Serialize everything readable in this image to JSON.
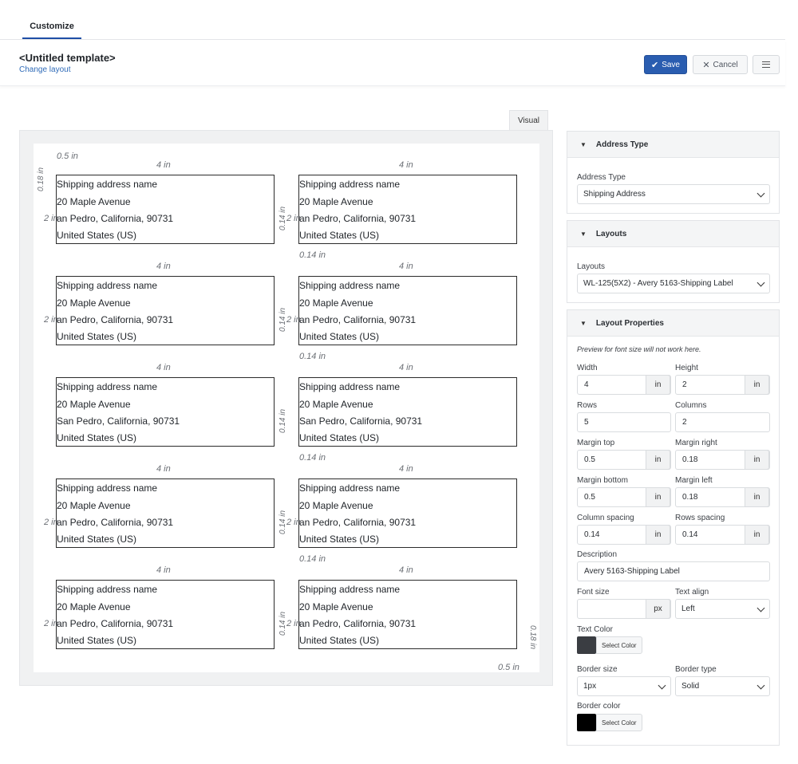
{
  "tabs": {
    "customize": "Customize",
    "visual": "Visual"
  },
  "header": {
    "title": "<Untitled template>",
    "change_layout": "Change layout",
    "save_label": "Save",
    "cancel_label": "Cancel"
  },
  "canvas": {
    "margin_top_label": "0.5 in",
    "margin_bottom_label": "0.5 in",
    "margin_side_label": "0.18 in",
    "width_label": "4 in",
    "height_label": "2 in",
    "spacing_label": "0.14 in",
    "label_lines": {
      "name": "Shipping address name",
      "street": "20 Maple Avenue",
      "city": "San Pedro, California, 90731",
      "city_clipped": "an Pedro, California, 90731",
      "country": "United States (US)"
    }
  },
  "panel": {
    "address_type": {
      "header": "Address Type",
      "field_label": "Address Type",
      "value": "Shipping Address"
    },
    "layouts": {
      "header": "Layouts",
      "field_label": "Layouts",
      "value": "WL-125(5X2) - Avery 5163-Shipping Label"
    },
    "props": {
      "header": "Layout Properties",
      "note": "Preview for font size will not work here.",
      "width_label": "Width",
      "width": "4",
      "width_unit": "in",
      "height_label": "Height",
      "height": "2",
      "height_unit": "in",
      "rows_label": "Rows",
      "rows": "5",
      "columns_label": "Columns",
      "columns": "2",
      "margin_top_label": "Margin top",
      "margin_top": "0.5",
      "margin_top_unit": "in",
      "margin_right_label": "Margin right",
      "margin_right": "0.18",
      "margin_right_unit": "in",
      "margin_bottom_label": "Margin bottom",
      "margin_bottom": "0.5",
      "margin_bottom_unit": "in",
      "margin_left_label": "Margin left",
      "margin_left": "0.18",
      "margin_left_unit": "in",
      "column_spacing_label": "Column spacing",
      "column_spacing": "0.14",
      "column_spacing_unit": "in",
      "rows_spacing_label": "Rows spacing",
      "rows_spacing": "0.14",
      "rows_spacing_unit": "in",
      "description_label": "Description",
      "description": "Avery 5163-Shipping Label",
      "font_size_label": "Font size",
      "font_size": "",
      "font_size_unit": "px",
      "text_align_label": "Text align",
      "text_align": "Left",
      "text_color_label": "Text Color",
      "text_color": "#3a3d42",
      "select_color": "Select Color",
      "border_size_label": "Border size",
      "border_size": "1px",
      "border_type_label": "Border type",
      "border_type": "Solid",
      "border_color_label": "Border color",
      "border_color": "#000000"
    }
  },
  "colors": {
    "accent": "#2a5db0",
    "link": "#2f6bb8"
  }
}
